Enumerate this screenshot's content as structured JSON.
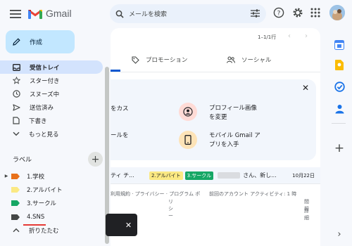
{
  "header": {
    "app_name": "Gmail",
    "search_placeholder": "メールを検索"
  },
  "compose": {
    "label": "作成"
  },
  "sidebar": {
    "items": [
      {
        "label": "受信トレイ",
        "icon": "inbox-icon"
      },
      {
        "label": "スター付き",
        "icon": "star-icon"
      },
      {
        "label": "スヌーズ中",
        "icon": "clock-icon"
      },
      {
        "label": "送信済み",
        "icon": "send-icon"
      },
      {
        "label": "下書き",
        "icon": "draft-icon"
      },
      {
        "label": "もっと見る",
        "icon": "chevron-down-icon"
      }
    ],
    "labels_title": "ラベル",
    "labels": [
      {
        "label": "1.学校",
        "color": "#e8711a",
        "expandable": true
      },
      {
        "label": "2.アルバイト",
        "color": "#fbe983",
        "expandable": false
      },
      {
        "label": "3.サークル",
        "color": "#16a765",
        "expandable": false
      },
      {
        "label": "4.SNS",
        "color": "#444746",
        "expandable": false
      }
    ],
    "collapse_label": "折りたたむ"
  },
  "toolbar": {
    "pager": "1–1/1行"
  },
  "tabs": {
    "promotions": "プロモーション",
    "social": "ソーシャル"
  },
  "promo": {
    "left_line1": "をカス",
    "left_line2": "ールを",
    "profile_line1": "プロフィール画像",
    "profile_line2": "を変更",
    "mobile_line1": "モバイル Gmail ア",
    "mobile_line2": "プリを入手"
  },
  "email": {
    "sender_fragment": "ティ チ...",
    "chip_arbeit": "2.アルバイト",
    "chip_circle": "3.サークル",
    "subject_fragment": "さん、新し...",
    "date": "10月22日",
    "chip_colors": {
      "arbeit": "#fbe983",
      "circle": "#16a765"
    }
  },
  "footer": {
    "links": "利用規約 · プライバシー · プログラム ポ",
    "links2": "リシー",
    "activity": "前回のアカウント アクティビティ: 1 時",
    "activity2": "間前",
    "details": "詳細"
  },
  "colors": {
    "accent": "#0b57d0",
    "compose_bg": "#c2e7ff",
    "active_nav": "#d3e3fd"
  }
}
